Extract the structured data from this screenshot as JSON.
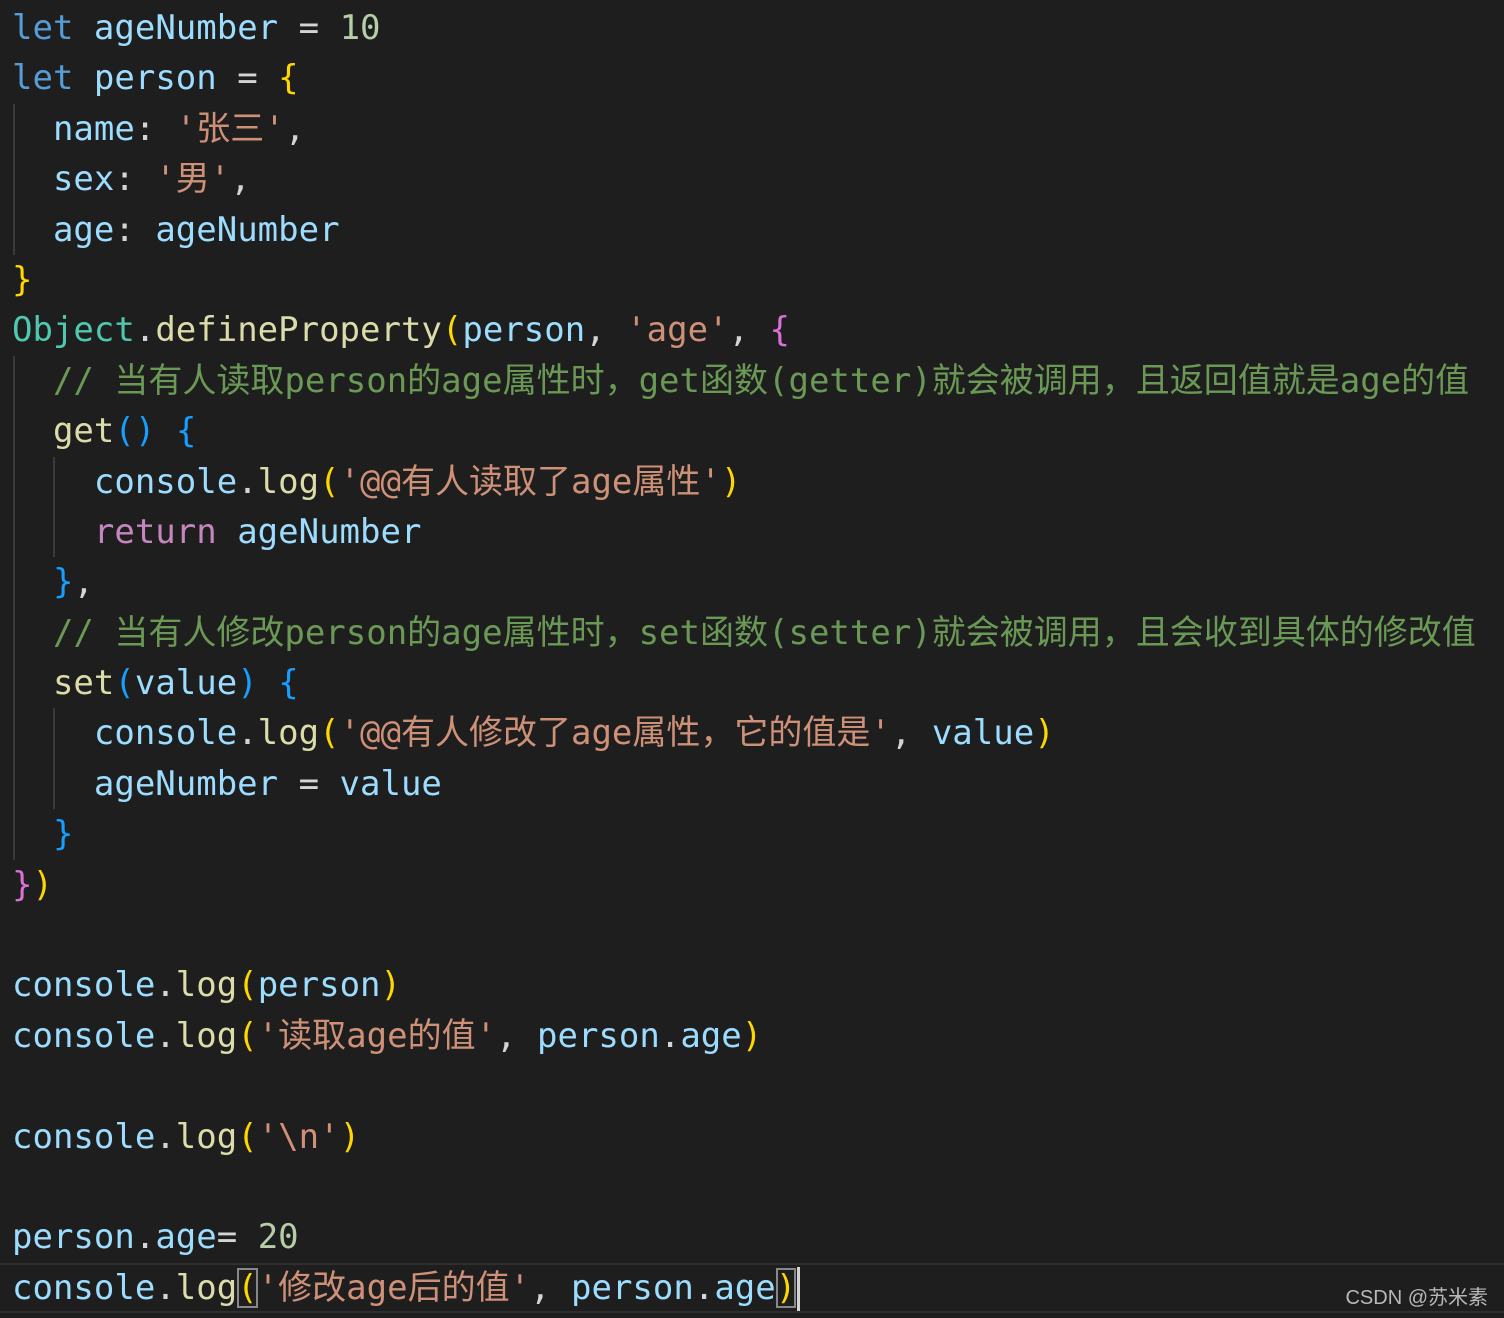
{
  "editor": {
    "lines": [
      {
        "indent": 0,
        "tokens": [
          [
            "kw",
            "let"
          ],
          [
            "op",
            " "
          ],
          [
            "var",
            "ageNumber"
          ],
          [
            "op",
            " = "
          ],
          [
            "num",
            "10"
          ]
        ]
      },
      {
        "indent": 0,
        "tokens": [
          [
            "kw",
            "let"
          ],
          [
            "op",
            " "
          ],
          [
            "var",
            "person"
          ],
          [
            "op",
            " = "
          ],
          [
            "br1",
            "{"
          ]
        ]
      },
      {
        "indent": 1,
        "tokens": [
          [
            "op",
            "  "
          ],
          [
            "var",
            "name"
          ],
          [
            "op",
            ": "
          ],
          [
            "str",
            "'张三'"
          ],
          [
            "op",
            ","
          ]
        ]
      },
      {
        "indent": 1,
        "tokens": [
          [
            "op",
            "  "
          ],
          [
            "var",
            "sex"
          ],
          [
            "op",
            ": "
          ],
          [
            "str",
            "'男'"
          ],
          [
            "op",
            ","
          ]
        ]
      },
      {
        "indent": 1,
        "tokens": [
          [
            "op",
            "  "
          ],
          [
            "var",
            "age"
          ],
          [
            "op",
            ": "
          ],
          [
            "var",
            "ageNumber"
          ]
        ]
      },
      {
        "indent": 0,
        "tokens": [
          [
            "br1",
            "}"
          ]
        ]
      },
      {
        "indent": 0,
        "tokens": [
          [
            "type",
            "Object"
          ],
          [
            "op",
            "."
          ],
          [
            "fn",
            "defineProperty"
          ],
          [
            "br1",
            "("
          ],
          [
            "var",
            "person"
          ],
          [
            "op",
            ", "
          ],
          [
            "str",
            "'age'"
          ],
          [
            "op",
            ", "
          ],
          [
            "br2",
            "{"
          ]
        ]
      },
      {
        "indent": 1,
        "tokens": [
          [
            "op",
            "  "
          ],
          [
            "cmt",
            "// 当有人读取person的age属性时，get函数(getter)就会被调用，且返回值就是age的值"
          ]
        ]
      },
      {
        "indent": 1,
        "tokens": [
          [
            "op",
            "  "
          ],
          [
            "fn",
            "get"
          ],
          [
            "br3",
            "()"
          ],
          [
            "op",
            " "
          ],
          [
            "br3",
            "{"
          ]
        ]
      },
      {
        "indent": 2,
        "tokens": [
          [
            "op",
            "    "
          ],
          [
            "var",
            "console"
          ],
          [
            "op",
            "."
          ],
          [
            "fn",
            "log"
          ],
          [
            "br1",
            "("
          ],
          [
            "str",
            "'@@有人读取了age属性'"
          ],
          [
            "br1",
            ")"
          ]
        ]
      },
      {
        "indent": 2,
        "tokens": [
          [
            "op",
            "    "
          ],
          [
            "ctl",
            "return"
          ],
          [
            "op",
            " "
          ],
          [
            "var",
            "ageNumber"
          ]
        ]
      },
      {
        "indent": 1,
        "tokens": [
          [
            "op",
            "  "
          ],
          [
            "br3",
            "}"
          ],
          [
            "op",
            ","
          ]
        ]
      },
      {
        "indent": 1,
        "tokens": [
          [
            "op",
            "  "
          ],
          [
            "cmt",
            "// 当有人修改person的age属性时，set函数(setter)就会被调用，且会收到具体的修改值"
          ]
        ]
      },
      {
        "indent": 1,
        "tokens": [
          [
            "op",
            "  "
          ],
          [
            "fn",
            "set"
          ],
          [
            "br3",
            "("
          ],
          [
            "var",
            "value"
          ],
          [
            "br3",
            ")"
          ],
          [
            "op",
            " "
          ],
          [
            "br3",
            "{"
          ]
        ]
      },
      {
        "indent": 2,
        "tokens": [
          [
            "op",
            "    "
          ],
          [
            "var",
            "console"
          ],
          [
            "op",
            "."
          ],
          [
            "fn",
            "log"
          ],
          [
            "br1",
            "("
          ],
          [
            "str",
            "'@@有人修改了age属性，它的值是'"
          ],
          [
            "op",
            ", "
          ],
          [
            "var",
            "value"
          ],
          [
            "br1",
            ")"
          ]
        ]
      },
      {
        "indent": 2,
        "tokens": [
          [
            "op",
            "    "
          ],
          [
            "var",
            "ageNumber"
          ],
          [
            "op",
            " = "
          ],
          [
            "var",
            "value"
          ]
        ]
      },
      {
        "indent": 1,
        "tokens": [
          [
            "op",
            "  "
          ],
          [
            "br3",
            "}"
          ]
        ]
      },
      {
        "indent": 0,
        "tokens": [
          [
            "br2",
            "}"
          ],
          [
            "br1",
            ")"
          ]
        ]
      },
      {
        "indent": 0,
        "tokens": []
      },
      {
        "indent": 0,
        "tokens": [
          [
            "var",
            "console"
          ],
          [
            "op",
            "."
          ],
          [
            "fn",
            "log"
          ],
          [
            "br1",
            "("
          ],
          [
            "var",
            "person"
          ],
          [
            "br1",
            ")"
          ]
        ]
      },
      {
        "indent": 0,
        "tokens": [
          [
            "var",
            "console"
          ],
          [
            "op",
            "."
          ],
          [
            "fn",
            "log"
          ],
          [
            "br1",
            "("
          ],
          [
            "str",
            "'读取age的值'"
          ],
          [
            "op",
            ", "
          ],
          [
            "var",
            "person"
          ],
          [
            "op",
            "."
          ],
          [
            "var",
            "age"
          ],
          [
            "br1",
            ")"
          ]
        ]
      },
      {
        "indent": 0,
        "tokens": []
      },
      {
        "indent": 0,
        "tokens": [
          [
            "var",
            "console"
          ],
          [
            "op",
            "."
          ],
          [
            "fn",
            "log"
          ],
          [
            "br1",
            "("
          ],
          [
            "str",
            "'\\n'"
          ],
          [
            "br1",
            ")"
          ]
        ]
      },
      {
        "indent": 0,
        "tokens": []
      },
      {
        "indent": 0,
        "tokens": [
          [
            "var",
            "person"
          ],
          [
            "op",
            "."
          ],
          [
            "var",
            "age"
          ],
          [
            "op",
            "= "
          ],
          [
            "num",
            "20"
          ]
        ]
      },
      {
        "indent": 0,
        "current": true,
        "tokens": [
          [
            "var",
            "console"
          ],
          [
            "op",
            "."
          ],
          [
            "fn",
            "log"
          ],
          [
            "br1m",
            "("
          ],
          [
            "str",
            "'修改age后的值'"
          ],
          [
            "op",
            ", "
          ],
          [
            "var",
            "person"
          ],
          [
            "op",
            "."
          ],
          [
            "var",
            "age"
          ],
          [
            "br1m",
            ")"
          ]
        ]
      }
    ]
  },
  "watermark": "CSDN @苏米素"
}
